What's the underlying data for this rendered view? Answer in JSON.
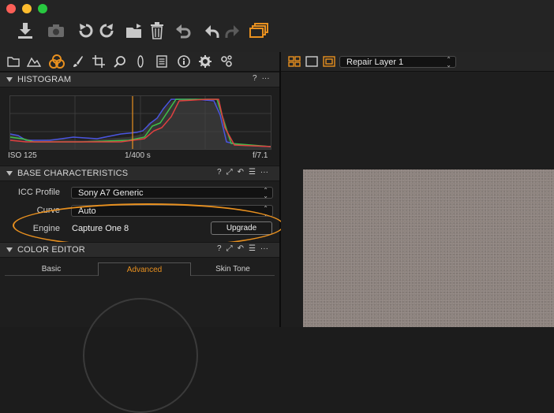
{
  "histogram": {
    "title": "HISTOGRAM",
    "iso": "ISO 125",
    "shutter": "1/400 s",
    "aperture": "f/7.1"
  },
  "base_characteristics": {
    "title": "BASE CHARACTERISTICS",
    "icc_label": "ICC Profile",
    "icc_value": "Sony A7 Generic",
    "curve_label": "Curve",
    "curve_value": "Auto",
    "engine_label": "Engine",
    "engine_value": "Capture One 8",
    "upgrade_label": "Upgrade"
  },
  "color_editor": {
    "title": "COLOR EDITOR",
    "tabs": [
      "Basic",
      "Advanced",
      "Skin Tone"
    ],
    "active_tab": "Advanced"
  },
  "viewer": {
    "layer_select": "Repair Layer 1"
  },
  "header_glyphs": {
    "help": "?",
    "more": "···"
  },
  "colors": {
    "accent_orange": "#e8901f",
    "hist_red": "#e04040",
    "hist_green": "#3ec04a",
    "hist_blue": "#4a55e0"
  }
}
